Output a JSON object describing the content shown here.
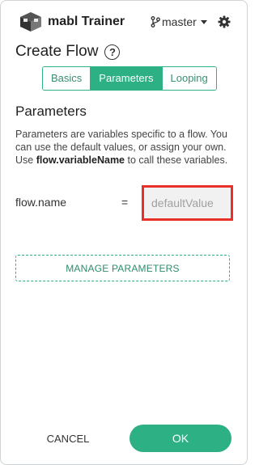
{
  "header": {
    "app_title": "mabl Trainer",
    "branch_label": "master",
    "logo_icon": "mabl-logo-icon",
    "branch_icon": "git-branch-icon",
    "settings_icon": "gear-icon"
  },
  "page": {
    "title": "Create Flow",
    "help_icon": "help-circle-icon",
    "help_glyph": "?"
  },
  "tabs": [
    {
      "label": "Basics",
      "active": false
    },
    {
      "label": "Parameters",
      "active": true
    },
    {
      "label": "Looping",
      "active": false
    }
  ],
  "section": {
    "title": "Parameters",
    "desc_part1": "Parameters are variables specific to a flow. You can use the default values, or assign your own. Use ",
    "desc_bold": "flow.variableName",
    "desc_part2": " to call these variables."
  },
  "parameter": {
    "name": "flow.name",
    "equals": "=",
    "placeholder": "defaultValue",
    "value": ""
  },
  "manage_label": "MANAGE PARAMETERS",
  "footer": {
    "cancel_label": "CANCEL",
    "ok_label": "OK"
  },
  "colors": {
    "accent": "#2eb085",
    "highlight_border": "#e8302a"
  }
}
